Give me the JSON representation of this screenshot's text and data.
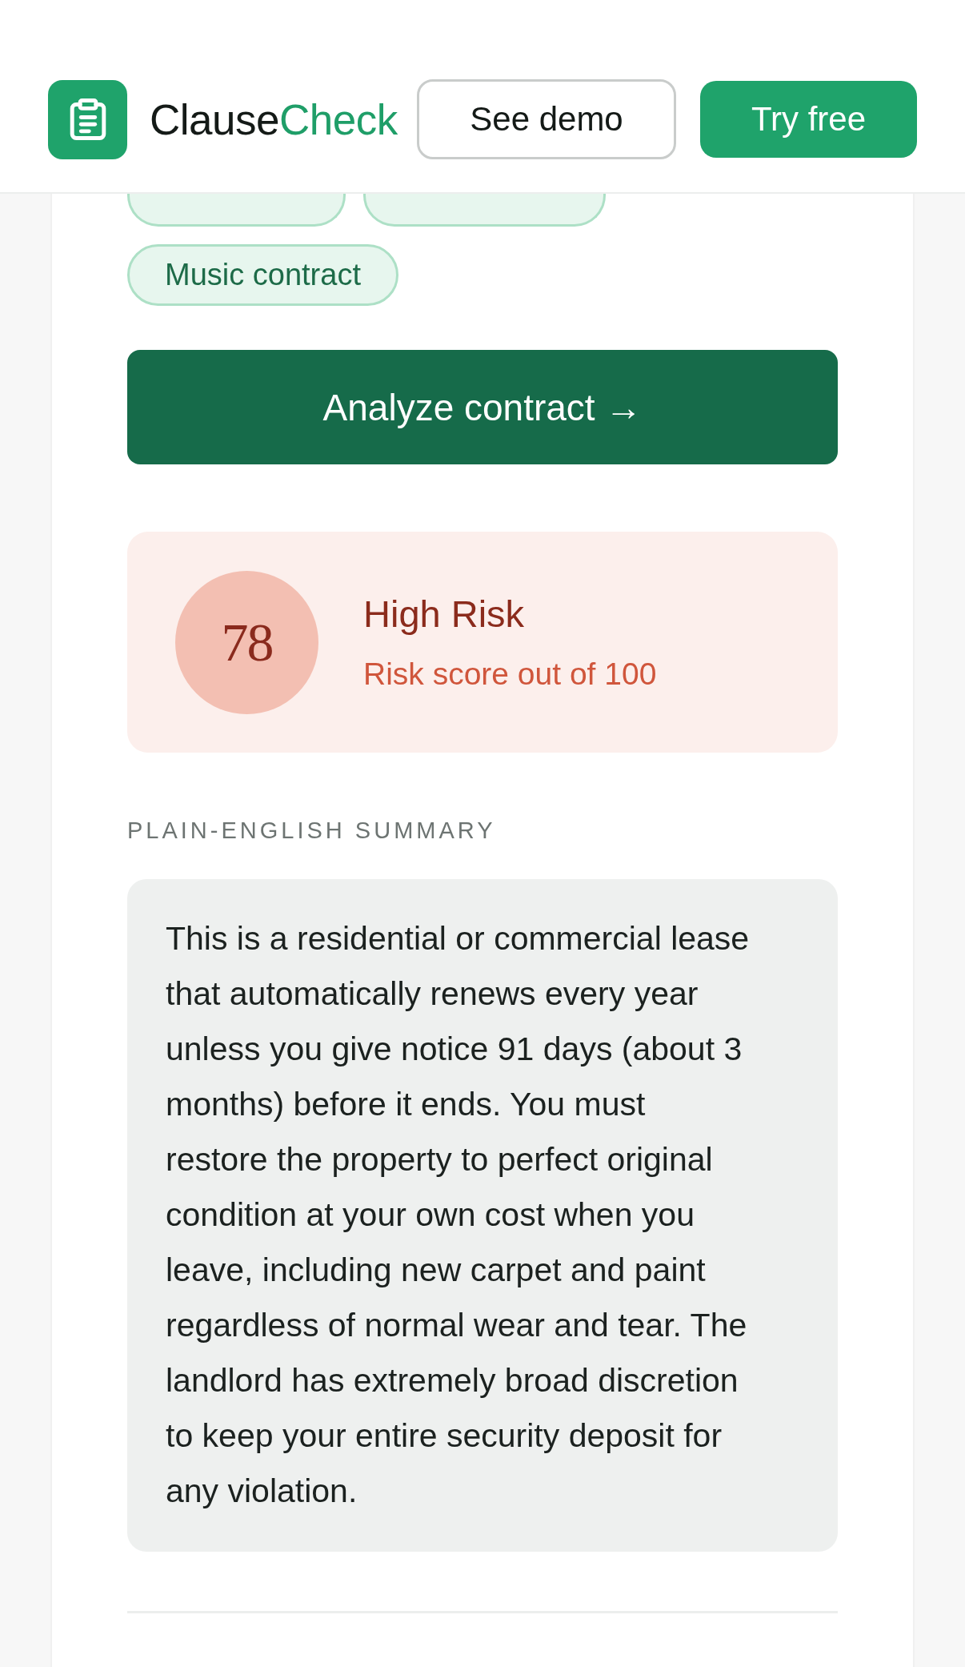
{
  "header": {
    "brand": {
      "name": "Clause",
      "accent": "Check"
    },
    "buttons": [
      {
        "label": "See demo",
        "kind": "outline"
      },
      {
        "label": "Try free",
        "kind": "primary"
      }
    ]
  },
  "samples": [
    {
      "kind": "covered"
    },
    {
      "kind": "covered"
    },
    {
      "kind": "full",
      "label": "Music contract"
    }
  ],
  "analyze_button": {
    "label": "Analyze contract →"
  },
  "risk": {
    "score": "78",
    "label": "High Risk",
    "caption": "Risk score out of 100"
  },
  "summary": {
    "heading": "PLAIN-ENGLISH SUMMARY",
    "text": "This is a residential or commercial lease that automatically renews every year unless you give notice 91 days (about 3 months) before it ends. You must restore the property to perfect original condition at your own cost when you leave, including new carpet and paint regardless of normal wear and tear. The landlord has extremely broad discretion to keep your entire security deposit for any violation."
  }
}
